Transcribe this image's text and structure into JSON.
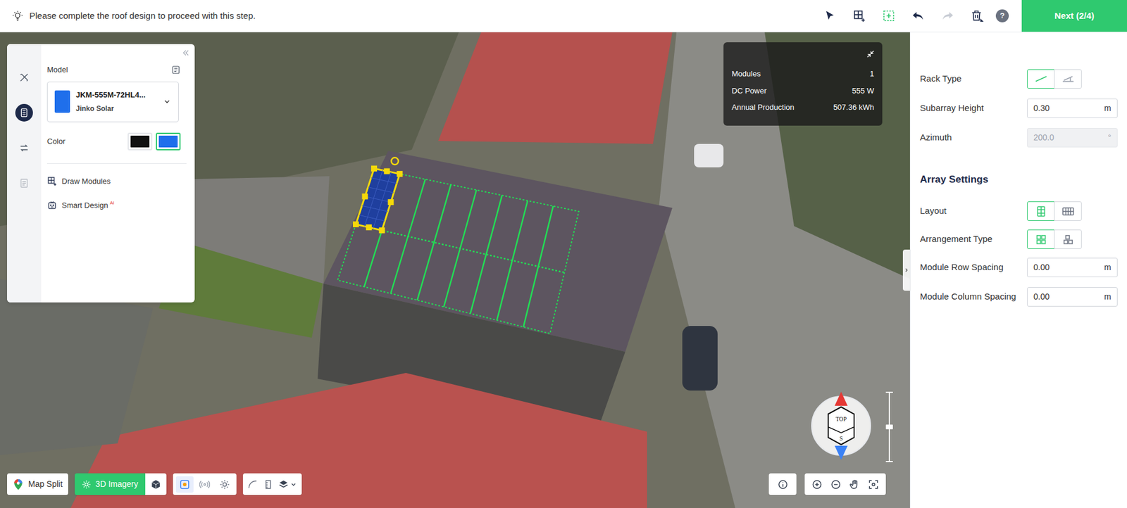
{
  "banner": {
    "text": "Please complete the roof design to proceed with this step."
  },
  "toolbar": {
    "tools": [
      {
        "state": "normal"
      },
      {
        "state": "normal"
      },
      {
        "state": "selected"
      },
      {
        "state": "normal"
      },
      {
        "state": "disabled"
      },
      {
        "state": "normal"
      }
    ],
    "help": "?",
    "next": "Next (2/4)"
  },
  "left_panel": {
    "rail": [
      {
        "selected": false
      },
      {
        "selected": true
      },
      {
        "selected": false
      },
      {
        "selected": false
      }
    ],
    "model_label": "Model",
    "model_name": "JKM-555M-72HL4...",
    "model_brand": "Jinko Solar",
    "color_label": "Color",
    "colors": [
      {
        "color": "#111111",
        "selected": false
      },
      {
        "color": "#1f6feb",
        "selected": true
      }
    ],
    "actions": [
      {
        "label": "Draw Modules",
        "badge": ""
      },
      {
        "label": "Smart Design",
        "badge": "AI"
      }
    ]
  },
  "stats": [
    {
      "label": "Modules",
      "value": "1"
    },
    {
      "label": "DC Power",
      "value": "555 W"
    },
    {
      "label": "Annual Production",
      "value": "507.36 kWh"
    }
  ],
  "canvas": {
    "grid": {
      "rows": 2,
      "cols": 8
    },
    "modules": [
      {
        "row": 0,
        "col": 0,
        "selected": true
      }
    ]
  },
  "compass": {
    "top": "TOP",
    "bottom": "S",
    "zoom_level": 0.5
  },
  "bottom_bar": {
    "map_split": "Map Split",
    "imagery": {
      "label": "3D Imagery",
      "on": true
    },
    "view_tools": [
      {
        "selected": true
      },
      {
        "selected": false
      },
      {
        "selected": false
      }
    ]
  },
  "right_panel": {
    "rack_type": {
      "label": "Rack Type",
      "options": [
        {
          "selected": true
        },
        {
          "selected": false
        }
      ]
    },
    "height": {
      "label": "Subarray Height",
      "value": "0.30",
      "unit": "m"
    },
    "azimuth": {
      "label": "Azimuth",
      "value": "200.0",
      "unit": "°",
      "disabled": true
    },
    "section": "Array Settings",
    "layout": {
      "label": "Layout",
      "options": [
        {
          "selected": true
        },
        {
          "selected": false
        }
      ]
    },
    "arrangement": {
      "label": "Arrangement Type",
      "options": [
        {
          "selected": true
        },
        {
          "selected": false
        }
      ]
    },
    "row_spacing": {
      "label": "Module Row Spacing",
      "value": "0.00",
      "unit": "m"
    },
    "col_spacing": {
      "label": "Module Column Spacing",
      "value": "0.00",
      "unit": "m"
    }
  }
}
